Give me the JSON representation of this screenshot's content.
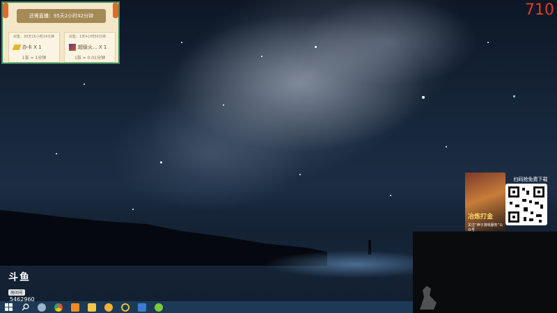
{
  "overlay": {
    "banner_text": "还需直播：95天2小时42分钟",
    "cards": [
      {
        "tag": "出售：30天15小时24分钟",
        "item": "办卡 X 1",
        "rate": "1张 = 1分钟",
        "icon": "key-icon"
      },
      {
        "tag": "出售：1天4小时50分钟",
        "item": "超级火... X 1",
        "rate": "1张 = 0.01分钟",
        "icon": "fire-icon"
      }
    ]
  },
  "counter": "710",
  "promo": {
    "scan_label": "扫码抢免费下载",
    "title": "冶炼打金",
    "subtitle": "关注“神子游戏服务”公众号"
  },
  "logo": {
    "mark": "斗鱼",
    "sub": "房间号",
    "room_id": "5462960"
  },
  "taskbar": {
    "items": [
      {
        "name": "start-icon",
        "color": "#ffffff"
      },
      {
        "name": "search-icon",
        "color": "#ffffff"
      },
      {
        "name": "steam-icon",
        "color": "#9bb4cc"
      },
      {
        "name": "chrome-icon",
        "color": "#e4503f"
      },
      {
        "name": "help-app-icon",
        "color": "#f08a24"
      },
      {
        "name": "game-app-icon",
        "color": "#f2c94c"
      },
      {
        "name": "face-app-icon",
        "color": "#f2b233"
      },
      {
        "name": "ring-app-icon",
        "color": "#e8c23a"
      },
      {
        "name": "wps-app-icon",
        "color": "#3a7bd5"
      },
      {
        "name": "green-app-icon",
        "color": "#79c93d"
      }
    ]
  }
}
